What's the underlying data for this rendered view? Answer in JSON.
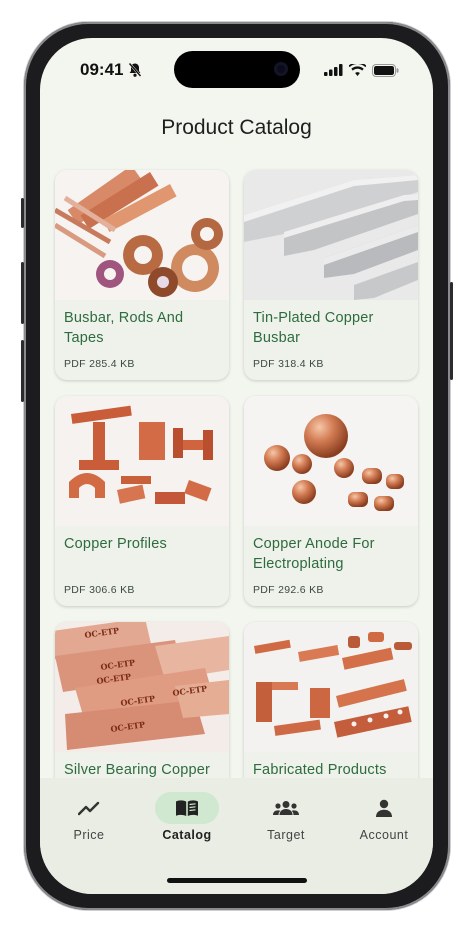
{
  "status": {
    "time": "09:41"
  },
  "header": {
    "title": "Product Catalog"
  },
  "products": [
    {
      "name": "Busbar, Rods And Tapes",
      "meta": "PDF 285.4 KB",
      "image": "copper-busbar-rods-tapes-photo"
    },
    {
      "name": "Tin-Plated Copper Busbar",
      "meta": "PDF 318.4 KB",
      "image": "tin-plated-busbar-photo"
    },
    {
      "name": "Copper Profiles",
      "meta": "PDF 306.6 KB",
      "image": "copper-profiles-photo"
    },
    {
      "name": "Copper Anode For Electroplating",
      "meta": "PDF 292.6 KB",
      "image": "copper-anode-balls-photo"
    },
    {
      "name": "Silver Bearing Copper",
      "meta": "",
      "image": "oc-etp-copper-sheets-photo"
    },
    {
      "name": "Fabricated Products",
      "meta": "",
      "image": "fabricated-copper-parts-photo"
    }
  ],
  "nav": {
    "items": [
      {
        "label": "Price",
        "icon": "trending-up-icon"
      },
      {
        "label": "Catalog",
        "icon": "book-open-icon",
        "active": true
      },
      {
        "label": "Target",
        "icon": "group-icon"
      },
      {
        "label": "Account",
        "icon": "person-icon"
      }
    ]
  },
  "colors": {
    "accent": "#2e6b3f",
    "nav_active": "#cfe8cf",
    "background": "#f3f6ef"
  }
}
